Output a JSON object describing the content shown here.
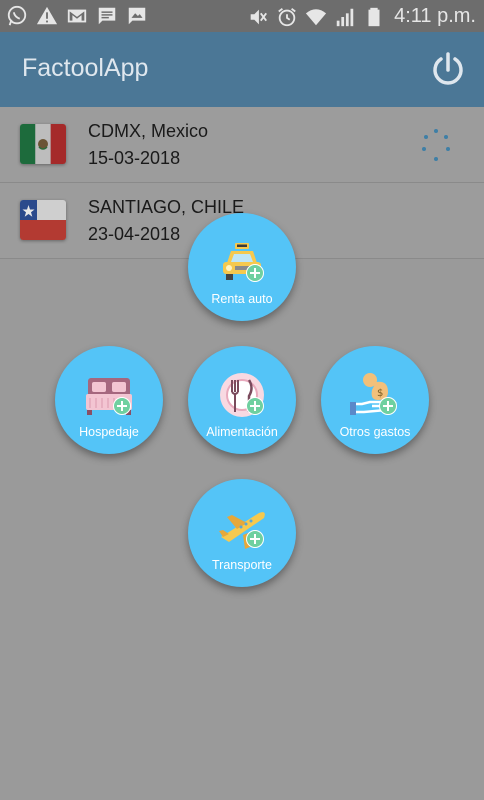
{
  "status_bar": {
    "time": "4:11 p.m.",
    "left_icons": [
      "whatsapp-icon",
      "warning-icon",
      "gmail-icon",
      "message-icon",
      "image-message-icon"
    ],
    "right_icons": [
      "mute-icon",
      "alarm-icon",
      "wifi-icon",
      "signal-icon",
      "battery-icon"
    ]
  },
  "app_bar": {
    "title": "FactoolApp",
    "power_icon": "power-icon"
  },
  "trips": [
    {
      "title": "CDMX, Mexico",
      "date": "15-03-2018",
      "flag": "mexico-flag-icon"
    },
    {
      "title": "SANTIAGO, CHILE",
      "date": "23-04-2018",
      "flag": "chile-flag-icon"
    }
  ],
  "expense_menu": [
    {
      "label": "Renta auto",
      "icon": "taxi-icon"
    },
    {
      "label": "Hospedaje",
      "icon": "bed-icon"
    },
    {
      "label": "Alimentación",
      "icon": "plate-icon"
    },
    {
      "label": "Otros gastos",
      "icon": "money-hand-icon"
    },
    {
      "label": "Transporte",
      "icon": "airplane-icon"
    }
  ],
  "colors": {
    "overlay": "#9a9a9a",
    "app_bar": "#4b7796",
    "fab": "#54c4f7",
    "plus_badge": "#6fd0a0"
  }
}
